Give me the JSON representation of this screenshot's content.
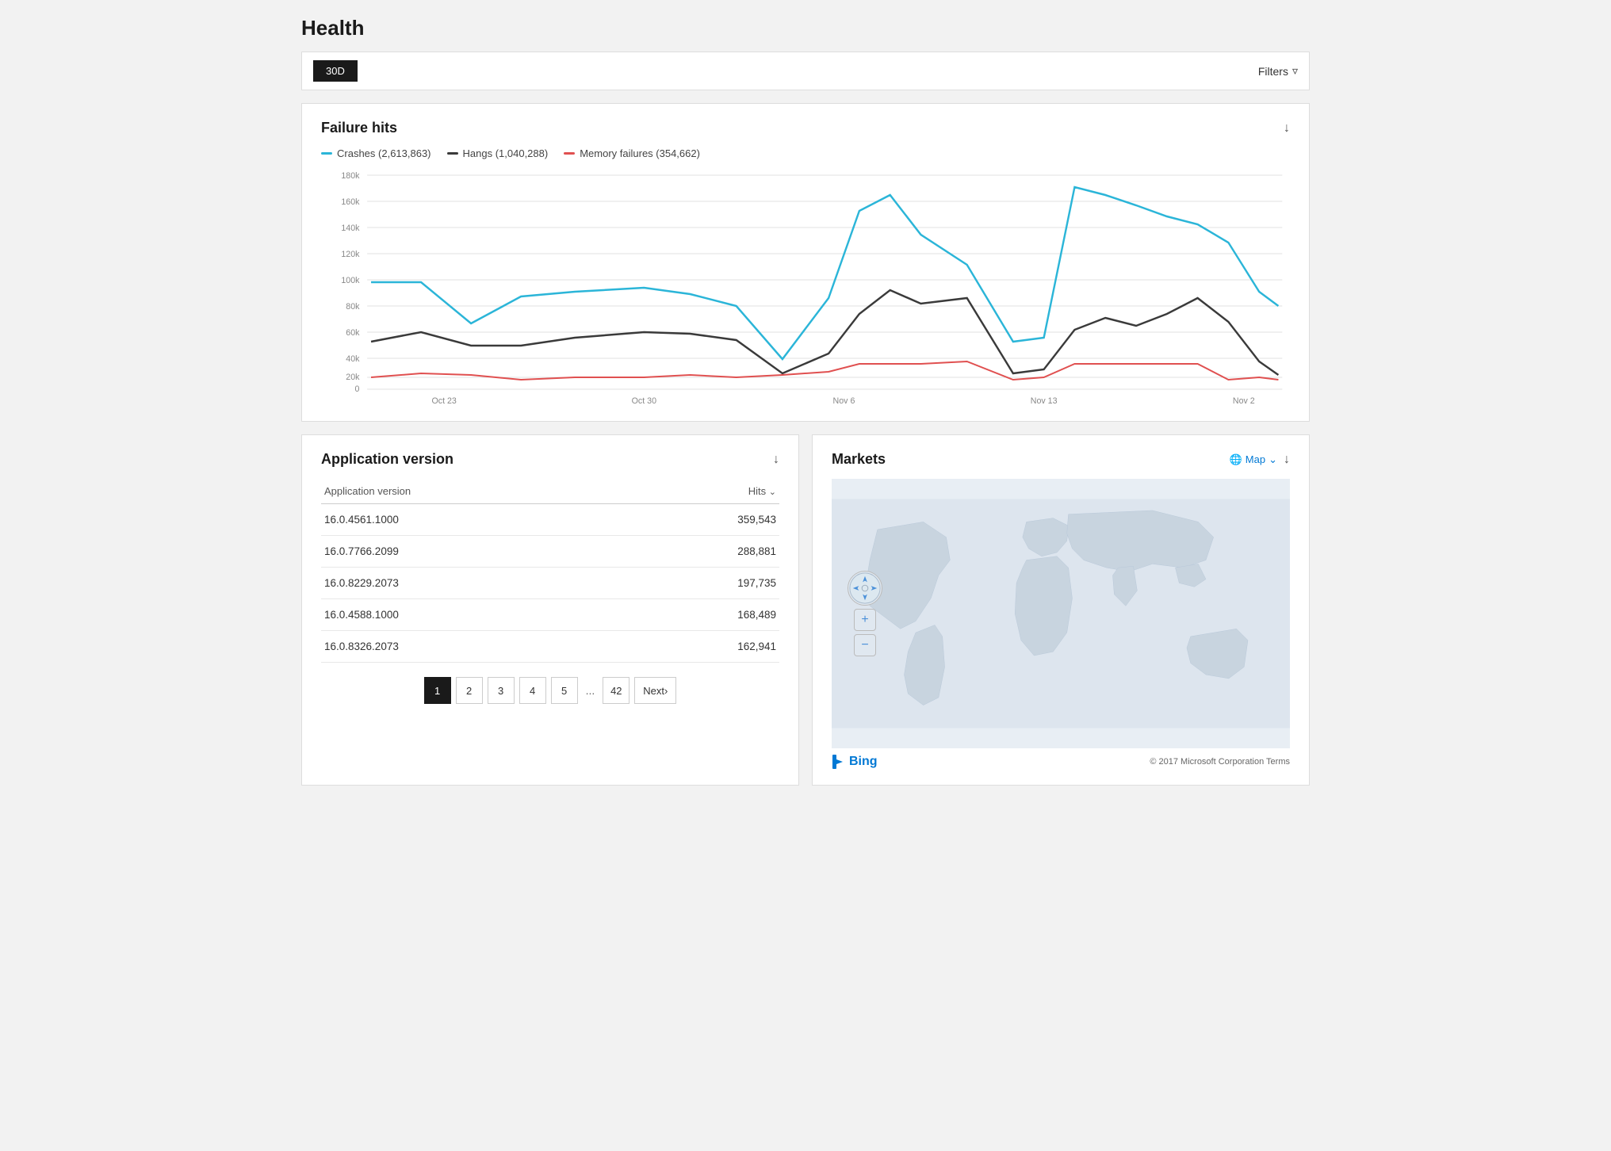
{
  "page": {
    "title": "Health"
  },
  "toolbar": {
    "period_label": "30D",
    "filters_label": "Filters"
  },
  "failure_hits": {
    "title": "Failure hits",
    "legend": [
      {
        "id": "crashes",
        "label": "Crashes (2,613,863)",
        "color": "#2bb5d8"
      },
      {
        "id": "hangs",
        "label": "Hangs (1,040,288)",
        "color": "#3a3a3a"
      },
      {
        "id": "memory",
        "label": "Memory failures (354,662)",
        "color": "#e05050"
      }
    ],
    "y_labels": [
      "180k",
      "160k",
      "140k",
      "120k",
      "100k",
      "80k",
      "60k",
      "40k",
      "20k",
      "0"
    ],
    "x_labels": [
      "Oct 23",
      "Oct 30",
      "Nov 6",
      "Nov 13",
      "Nov 2"
    ]
  },
  "app_version": {
    "title": "Application version",
    "col_version": "Application version",
    "col_hits": "Hits",
    "rows": [
      {
        "version": "16.0.4561.1000",
        "hits": "359,543"
      },
      {
        "version": "16.0.7766.2099",
        "hits": "288,881"
      },
      {
        "version": "16.0.8229.2073",
        "hits": "197,735"
      },
      {
        "version": "16.0.4588.1000",
        "hits": "168,489"
      },
      {
        "version": "16.0.8326.2073",
        "hits": "162,941"
      }
    ],
    "pagination": {
      "pages": [
        "1",
        "2",
        "3",
        "4",
        "5"
      ],
      "ellipsis": "...",
      "last_page": "42",
      "next_label": "Next",
      "active_page": "1"
    }
  },
  "markets": {
    "title": "Markets",
    "map_label": "Map",
    "copyright": "© 2017 Microsoft Corporation  Terms",
    "bing_label": "Bing"
  }
}
